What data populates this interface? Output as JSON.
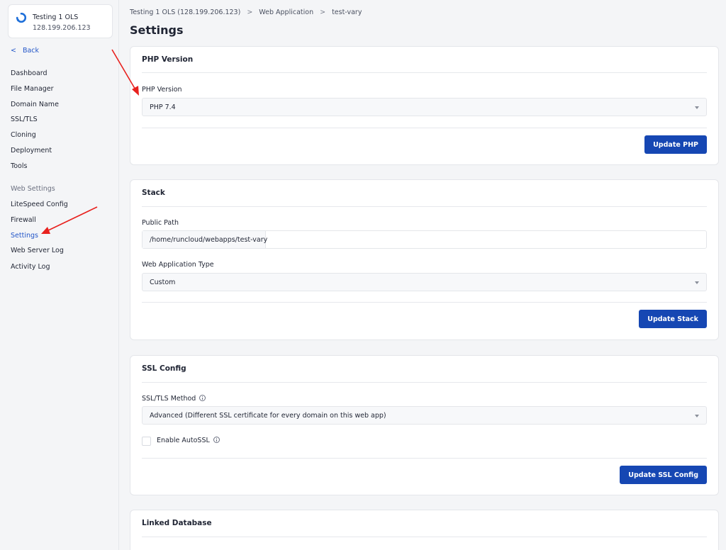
{
  "server": {
    "name": "Testing 1 OLS",
    "ip": "128.199.206.123"
  },
  "sidebar": {
    "back_label": "Back",
    "items": [
      {
        "label": "Dashboard"
      },
      {
        "label": "File Manager"
      },
      {
        "label": "Domain Name"
      },
      {
        "label": "SSL/TLS"
      },
      {
        "label": "Cloning"
      },
      {
        "label": "Deployment"
      },
      {
        "label": "Tools"
      }
    ],
    "section_label": "Web Settings",
    "web_settings_items": [
      {
        "label": "LiteSpeed Config"
      },
      {
        "label": "Firewall"
      },
      {
        "label": "Settings"
      },
      {
        "label": "Web Server Log"
      },
      {
        "label": "Activity Log"
      }
    ],
    "active_item": "Settings"
  },
  "breadcrumb": {
    "items": [
      "Testing 1 OLS (128.199.206.123)",
      "Web Application",
      "test-vary"
    ],
    "separator": ">"
  },
  "page_title": "Settings",
  "php_card": {
    "title": "PHP Version",
    "field_label": "PHP Version",
    "selected_value": "PHP 7.4",
    "button_label": "Update PHP"
  },
  "stack_card": {
    "title": "Stack",
    "public_path_label": "Public Path",
    "public_path_prefix": "/home/runcloud/webapps/test-vary",
    "public_path_value": "",
    "app_type_label": "Web Application Type",
    "app_type_value": "Custom",
    "button_label": "Update Stack"
  },
  "ssl_card": {
    "title": "SSL Config",
    "method_label": "SSL/TLS Method",
    "method_value": "Advanced (Different SSL certificate for every domain on this web app)",
    "autossl_label": "Enable AutoSSL",
    "autossl_checked": false,
    "button_label": "Update SSL Config"
  },
  "db_card": {
    "title": "Linked Database"
  },
  "colors": {
    "accent": "#1647b3",
    "link": "#2356c8",
    "annotation_arrow": "#e8211e"
  },
  "icons": {
    "logo": "runcloud-logo-icon",
    "back": "chevron-left-icon",
    "caret": "caret-down-icon",
    "info": "info-icon"
  }
}
